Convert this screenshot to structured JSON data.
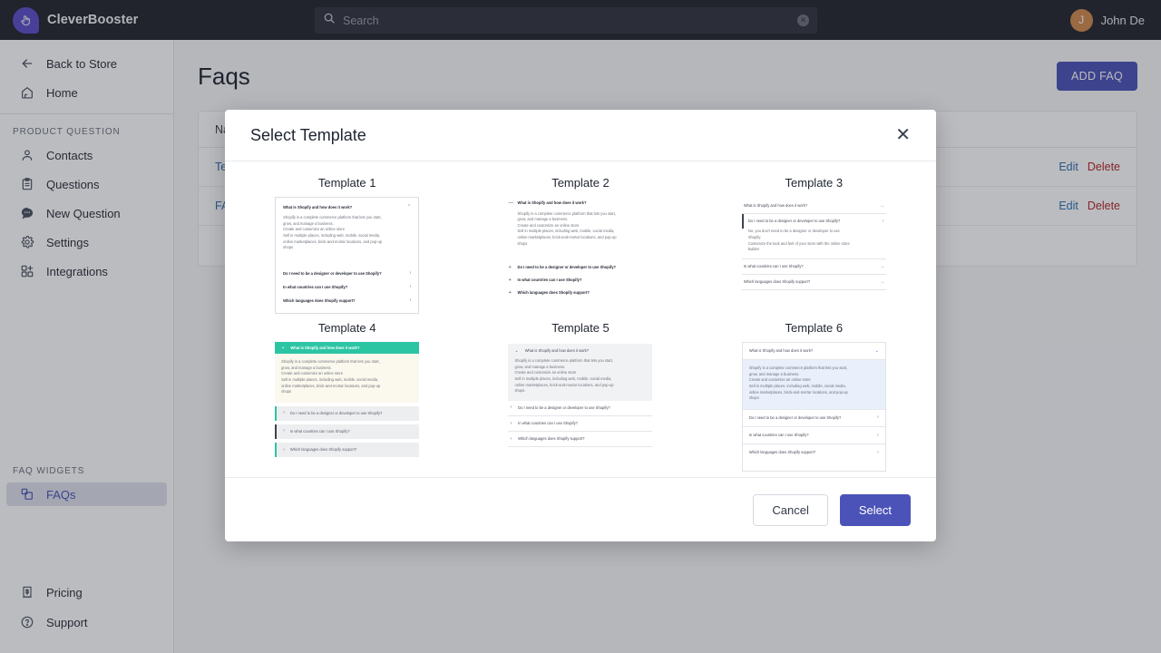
{
  "topbar": {
    "brand": "CleverBooster",
    "logo_icon": "click-hand-icon",
    "search": {
      "placeholder": "Search",
      "value": "",
      "icon": "search-icon",
      "clear_icon": "clear-icon"
    },
    "user": {
      "name": "John De",
      "initial": "J",
      "avatar_color": "#d08a4e"
    }
  },
  "sidebar": {
    "top_items": [
      {
        "label": "Back to Store",
        "icon": "arrow-left-icon"
      },
      {
        "label": "Home",
        "icon": "home-icon"
      }
    ],
    "section_label": "PRODUCT QUESTION",
    "items": [
      {
        "label": "Contacts",
        "icon": "user-icon"
      },
      {
        "label": "Questions",
        "icon": "clipboard-icon"
      },
      {
        "label": "New Question",
        "icon": "chat-bubble-icon"
      },
      {
        "label": "Settings",
        "icon": "gear-icon"
      },
      {
        "label": "Integrations",
        "icon": "grid-plus-icon"
      }
    ],
    "widgets_label": "FAQ WIDGETS",
    "widgets": [
      {
        "label": "FAQs",
        "icon": "layers-icon",
        "active": true
      }
    ],
    "bottom_items": [
      {
        "label": "Pricing",
        "icon": "receipt-dollar-icon"
      },
      {
        "label": "Support",
        "icon": "question-circle-icon"
      }
    ],
    "active_color": "#4b52b8"
  },
  "page": {
    "title": "Faqs",
    "add_button": "ADD FAQ",
    "accent_color": "#4b52b8",
    "table": {
      "columns": [
        "Name"
      ],
      "rows": [
        {
          "name": "Template",
          "edit": "Edit",
          "delete": "Delete"
        },
        {
          "name": "FAQ",
          "edit": "Edit",
          "delete": "Delete"
        }
      ],
      "edit_color": "#2f6fb5",
      "delete_color": "#b3262c"
    }
  },
  "modal": {
    "title": "Select Template",
    "close_icon": "close-icon",
    "cancel_label": "Cancel",
    "select_label": "Select",
    "faq": {
      "q1": "What is Shopify and how does it work?",
      "a1_lines": [
        "Shopify is a complete commerce platform that lets you start,",
        "grow, and manage a business.",
        "Create and customize an online store",
        "Sell in multiple places, including web, mobile, social media,",
        "online marketplaces, brick-and-mortar locations, and pop-up",
        "shops"
      ],
      "q2": "Do I need to be a designer or developer to use Shopify?",
      "a2_lines": [
        "No, you don't need to be a designer or developer to use",
        "Shopify.",
        "Customize the look and feel of your store with the online store",
        "builder"
      ],
      "q3": "In what countries can I use Shopify?",
      "q4": "Which languages does Shopify support?"
    },
    "templates": [
      {
        "title": "Template 1",
        "style": "bordered-chevron"
      },
      {
        "title": "Template 2",
        "style": "plain-plusminus"
      },
      {
        "title": "Template 3",
        "style": "divided-arrow"
      },
      {
        "title": "Template 4",
        "style": "teal-header",
        "accent": "#2cc5a4"
      },
      {
        "title": "Template 5",
        "style": "gray-panel"
      },
      {
        "title": "Template 6",
        "style": "blue-panel",
        "accent": "#3f6ae0"
      }
    ],
    "icons": {
      "chevron_up": "⌃",
      "chevron_right": "›",
      "chevron_down": "⌄",
      "minus": "—",
      "plus": "+",
      "arrow_right": "→",
      "arrow_up": "↑"
    }
  }
}
